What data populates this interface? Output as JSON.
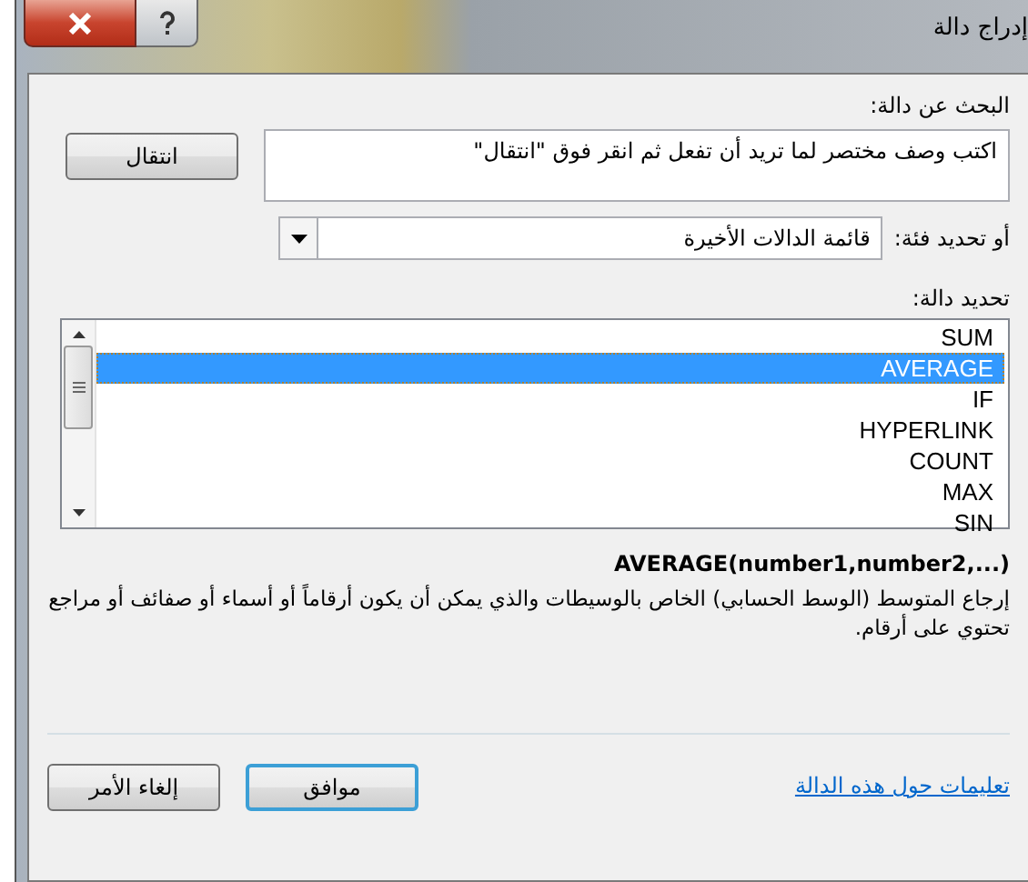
{
  "window": {
    "title": "إدراج دالة"
  },
  "search": {
    "label": "البحث عن دالة:",
    "value": "اكتب وصف مختصر لما تريد أن تفعل ثم انقر فوق \"انتقال\"",
    "go_button": "انتقال"
  },
  "category": {
    "label": "أو تحديد فئة:",
    "value": "قائمة الدالات الأخيرة"
  },
  "functions": {
    "label": "تحديد دالة:",
    "items": [
      {
        "name": "SUM",
        "selected": false
      },
      {
        "name": "AVERAGE",
        "selected": true
      },
      {
        "name": "IF",
        "selected": false
      },
      {
        "name": "HYPERLINK",
        "selected": false
      },
      {
        "name": "COUNT",
        "selected": false
      },
      {
        "name": "MAX",
        "selected": false
      },
      {
        "name": "SIN",
        "selected": false
      }
    ]
  },
  "syntax": "AVERAGE(number1,number2,...)",
  "description": "إرجاع المتوسط (الوسط الحسابي) الخاص بالوسيطات والذي يمكن أن يكون أرقاماً أو أسماء أو صفائف أو مراجع تحتوي على أرقام.",
  "help_link": "تعليمات حول هذه الدالة",
  "buttons": [
    {
      "label": "موافق",
      "default": true
    },
    {
      "label": "إلغاء الأمر",
      "default": false
    }
  ]
}
